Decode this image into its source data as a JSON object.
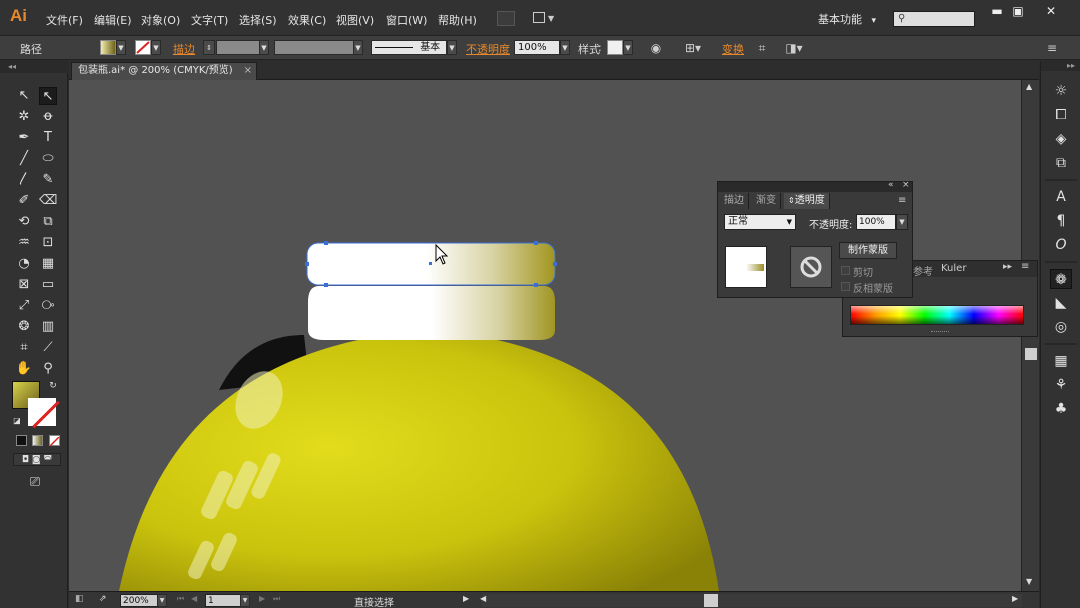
{
  "app": {
    "logo": "Ai"
  },
  "menu": [
    "文件(F)",
    "编辑(E)",
    "对象(O)",
    "文字(T)",
    "选择(S)",
    "效果(C)",
    "视图(V)",
    "窗口(W)",
    "帮助(H)"
  ],
  "workspace": {
    "label": "基本功能",
    "arrow": "▾"
  },
  "window_buttons": {
    "minimize": "▬",
    "maximize": "▣",
    "close": "✕"
  },
  "control_bar": {
    "object_label": "路径",
    "stroke_label": "描边",
    "stroke_profile": "基本",
    "opacity_label": "不透明度",
    "opacity_value": "100%",
    "style_label": "样式",
    "style_colon": ":",
    "recolor_label": "变换"
  },
  "document": {
    "tab_title": "包装瓶.ai* @ 200% (CMYK/预览)",
    "close": "×"
  },
  "status_bar": {
    "zoom": "200%",
    "artboard": "1",
    "tool_name": "直接选择"
  },
  "transparency_panel": {
    "tabs": [
      "描边",
      "渐变",
      "透明度"
    ],
    "active_tab": "透明度",
    "blend_mode": "正常",
    "opacity_label": "不透明度:",
    "opacity_value": "100%",
    "make_mask_button": "制作蒙版",
    "clip_label": "剪切",
    "invert_label": "反相蒙版"
  },
  "color_guide_panel": {
    "tabs": [
      "参考",
      "Kuler"
    ]
  },
  "colors": {
    "accent_orange": "#e8882c",
    "canvas_bg": "#525252",
    "bottle_yellow": "#c9c20c",
    "selection_blue": "#3a6fd8"
  }
}
